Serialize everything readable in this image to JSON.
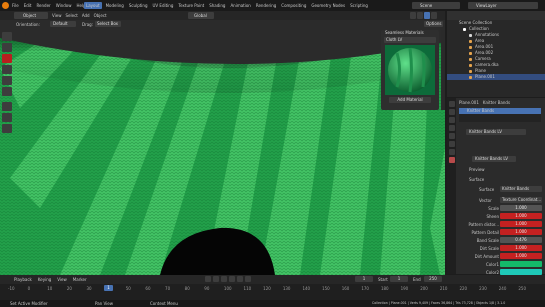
{
  "app": {
    "title_bar": "Blender [C:\\Users\\...\\Knitted_Fabric\\Knitted_Fabric.blend]"
  },
  "menus": [
    "File",
    "Edit",
    "Render",
    "Window",
    "Help"
  ],
  "workspaces": [
    "Layout",
    "Modeling",
    "Sculpting",
    "UV Editing",
    "Texture Paint",
    "Shading",
    "Animation",
    "Rendering",
    "Compositing",
    "Geometry Nodes",
    "Scripting"
  ],
  "scene": {
    "name": "Scene"
  },
  "view_layer": {
    "name": "ViewLayer"
  },
  "header": {
    "mode": "Object Mode",
    "view": "View",
    "select": "Select",
    "add": "Add",
    "object": "Object",
    "transform": "Global",
    "orientation_label": "Orientation:",
    "orientation": "Default",
    "drag_label": "Drag:",
    "drag": "Select Box",
    "options": "Options"
  },
  "material_preview": {
    "title": "Seamless Materials",
    "item": "Cloth LV",
    "button": "Add Material"
  },
  "side_tabs": [
    "Item",
    "Tool",
    "View",
    "Seamless Materials"
  ],
  "outliner": {
    "header": "Scene Collection",
    "items": [
      {
        "name": "Collection",
        "color": "#ffffff"
      },
      {
        "name": "Annotations",
        "color": "#d7d7d7"
      },
      {
        "name": "Area",
        "color": "#e6a44d"
      },
      {
        "name": "Area.001",
        "color": "#e6a44d"
      },
      {
        "name": "Area.002",
        "color": "#e6a44d"
      },
      {
        "name": "Camera",
        "color": "#e6a44d"
      },
      {
        "name": "camera.dka",
        "color": "#e6a44d"
      },
      {
        "name": "Plane",
        "color": "#e6a44d"
      },
      {
        "name": "Plane.001",
        "color": "#e6a44d"
      }
    ],
    "selected_index": 8
  },
  "properties": {
    "object": "Plane.001",
    "material_slot": "Knitter Bands",
    "material_name": "Knitter Bands LV",
    "node": "Knitter Bands LV",
    "preview_label": "Preview",
    "surface_label": "Surface",
    "surface_value": "Knitter Bands",
    "vector_label": "Vector",
    "vector_value": "Texture Coordinat...",
    "params": [
      {
        "label": "Scale",
        "value": "1.000",
        "red": false
      },
      {
        "label": "Sheen",
        "value": "1.000",
        "red": true
      },
      {
        "label": "Pattern distor...",
        "value": "1.000",
        "red": true
      },
      {
        "label": "Pattern Detail",
        "value": "1.000",
        "red": true
      },
      {
        "label": "Band Scale",
        "value": "0.476",
        "red": false
      },
      {
        "label": "Dirt Scale",
        "value": "1.000",
        "red": true
      },
      {
        "label": "Dirt Amount",
        "value": "1.000",
        "red": true
      },
      {
        "label": "Color1",
        "value": "",
        "color": "#14b86a"
      },
      {
        "label": "Color2",
        "value": "",
        "color": "#1fc9b8"
      },
      {
        "label": "Color Variation",
        "value": "0.303",
        "red": true
      }
    ]
  },
  "timeline": {
    "playback": "Playback",
    "keying": "Keying",
    "view": "View",
    "marker": "Marker",
    "current_frame": "1",
    "start_label": "Start",
    "start": "1",
    "end_label": "End",
    "end": "250",
    "ticks": [
      "-10",
      "0",
      "10",
      "20",
      "30",
      "40",
      "50",
      "60",
      "70",
      "80",
      "90",
      "100",
      "110",
      "120",
      "130",
      "140",
      "150",
      "160",
      "170",
      "180",
      "190",
      "200",
      "210",
      "220",
      "230",
      "240",
      "250"
    ]
  },
  "status": {
    "left": "Set Active Modifier",
    "mid1": "Pan View",
    "mid2": "Context Menu",
    "right": "Collection | Plane.001 | Verts 9,409 | Faces 36,864 | Tris 73,728 | Objects 1/8 | 3.1.0"
  }
}
